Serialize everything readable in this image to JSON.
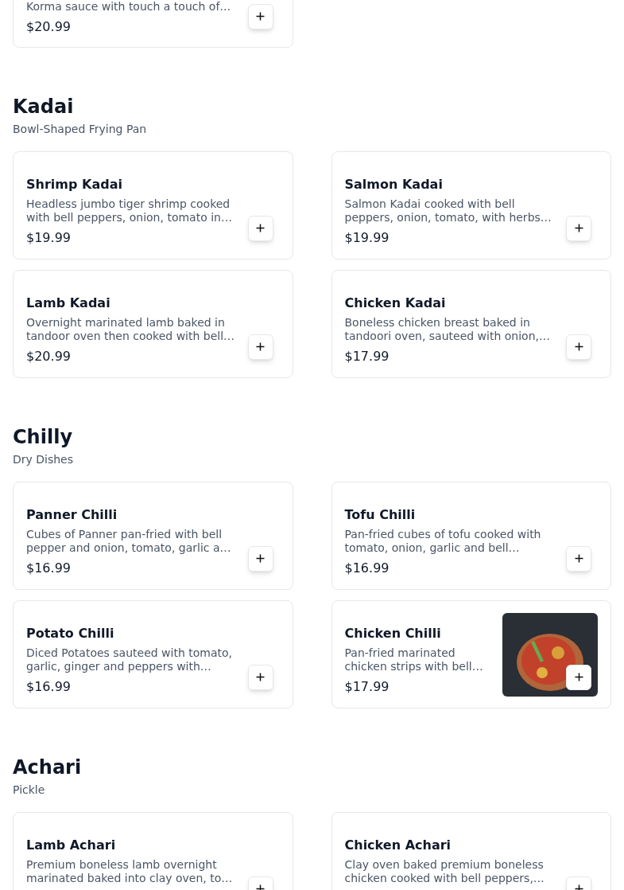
{
  "sections": [
    {
      "items": [
        {
          "description": "Korma sauce with touch a touch of…",
          "price": "$20.99",
          "photo": false
        }
      ]
    },
    {
      "title": "Kadai",
      "subtitle": "Bowl-Shaped Frying Pan",
      "items": [
        {
          "name": "Shrimp Kadai",
          "description": "Headless jumbo tiger shrimp cooked with bell peppers, onion, tomato in…",
          "price": "$19.99",
          "photo": false
        },
        {
          "name": "Salmon Kadai",
          "description": "Salmon Kadai cooked with bell peppers, onion, tomato, with herbs…",
          "price": "$19.99",
          "photo": false
        },
        {
          "name": "Lamb Kadai",
          "description": "Overnight marinated lamb baked in tandoor oven then cooked with bell…",
          "price": "$20.99",
          "photo": false
        },
        {
          "name": "Chicken Kadai",
          "description": "Boneless chicken breast baked in tandoori oven, sauteed with onion,…",
          "price": "$17.99",
          "photo": false
        }
      ]
    },
    {
      "title": "Chilly",
      "subtitle": "Dry Dishes",
      "items": [
        {
          "name": "Panner Chilli",
          "description": "Cubes of Panner pan-fried with bell pepper and onion, tomato, garlic a…",
          "price": "$16.99",
          "photo": false
        },
        {
          "name": "Tofu Chilli",
          "description": "Pan-fried cubes of tofu cooked with tomato, onion, garlic and bell…",
          "price": "$16.99",
          "photo": false
        },
        {
          "name": "Potato Chilli",
          "description": "Diced Potatoes sauteed with tomato, garlic, ginger and peppers with…",
          "price": "$16.99",
          "photo": false
        },
        {
          "name": "Chicken Chilli",
          "description": "Pan-fried marinated chicken strips with bell…",
          "price": "$17.99",
          "photo": true
        }
      ]
    },
    {
      "title": "Achari",
      "subtitle": "Pickle",
      "items": [
        {
          "name": "Lamb Achari",
          "description": "Premium boneless lamb overnight marinated baked into clay oven, to…",
          "photo": false
        },
        {
          "name": "Chicken Achari",
          "description": "Clay oven baked premium boneless chicken cooked with bell peppers,…",
          "photo": false
        }
      ]
    }
  ]
}
